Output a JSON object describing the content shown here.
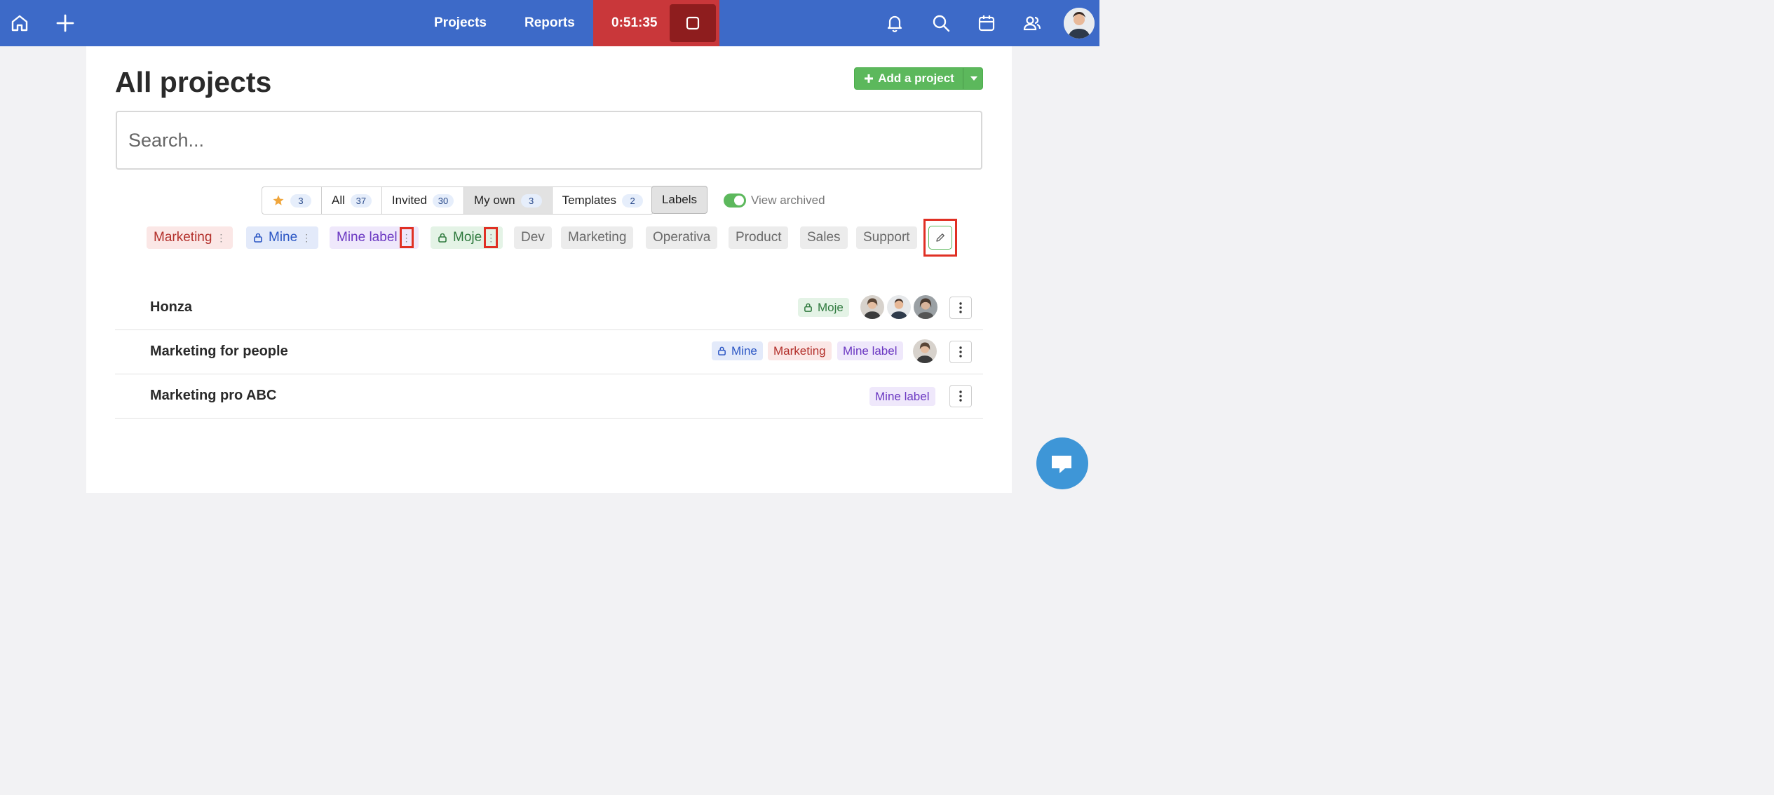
{
  "topbar": {
    "icons": [
      "home-icon",
      "plus-icon",
      "bell-icon",
      "search-icon",
      "calendar-icon",
      "users-icon"
    ],
    "nav": {
      "projects": "Projects",
      "reports": "Reports"
    },
    "timer": "0:51:35",
    "colors": {
      "bar": "#3d6ac8",
      "timer": "#c9373a",
      "stop": "#8e1d1e"
    }
  },
  "page": {
    "title": "All projects",
    "add_button": "Add a project",
    "search_placeholder": "Search..."
  },
  "filters": {
    "tabs": [
      {
        "label": "",
        "icon": "star-icon",
        "count": "3"
      },
      {
        "label": "All",
        "count": "37"
      },
      {
        "label": "Invited",
        "count": "30"
      },
      {
        "label": "My own",
        "count": "3",
        "active": true
      },
      {
        "label": "Templates",
        "count": "2"
      }
    ],
    "labels_button": "Labels",
    "view_archived": "View archived",
    "view_archived_on": true
  },
  "labels": [
    {
      "name": "Marketing",
      "color": "red",
      "menu": true
    },
    {
      "name": "Mine",
      "color": "blue",
      "menu": true,
      "lock": true
    },
    {
      "name": "Mine label",
      "color": "purple",
      "menu": true
    },
    {
      "name": "Moje",
      "color": "green",
      "menu": true,
      "lock": true
    },
    {
      "name": "Dev",
      "color": "gray"
    },
    {
      "name": "Marketing",
      "color": "gray"
    },
    {
      "name": "Operativa",
      "color": "gray"
    },
    {
      "name": "Product",
      "color": "gray"
    },
    {
      "name": "Sales",
      "color": "gray"
    },
    {
      "name": "Support",
      "color": "gray"
    }
  ],
  "projects": [
    {
      "name": "Honza",
      "tags": [
        {
          "name": "Moje",
          "color": "green",
          "lock": true
        }
      ],
      "members": 3
    },
    {
      "name": "Marketing for people",
      "tags": [
        {
          "name": "Mine",
          "color": "blue",
          "lock": true
        },
        {
          "name": "Marketing",
          "color": "red"
        },
        {
          "name": "Mine label",
          "color": "purple"
        }
      ],
      "members": 1
    },
    {
      "name": "Marketing pro ABC",
      "tags": [
        {
          "name": "Mine label",
          "color": "purple"
        }
      ],
      "members": 0
    }
  ]
}
